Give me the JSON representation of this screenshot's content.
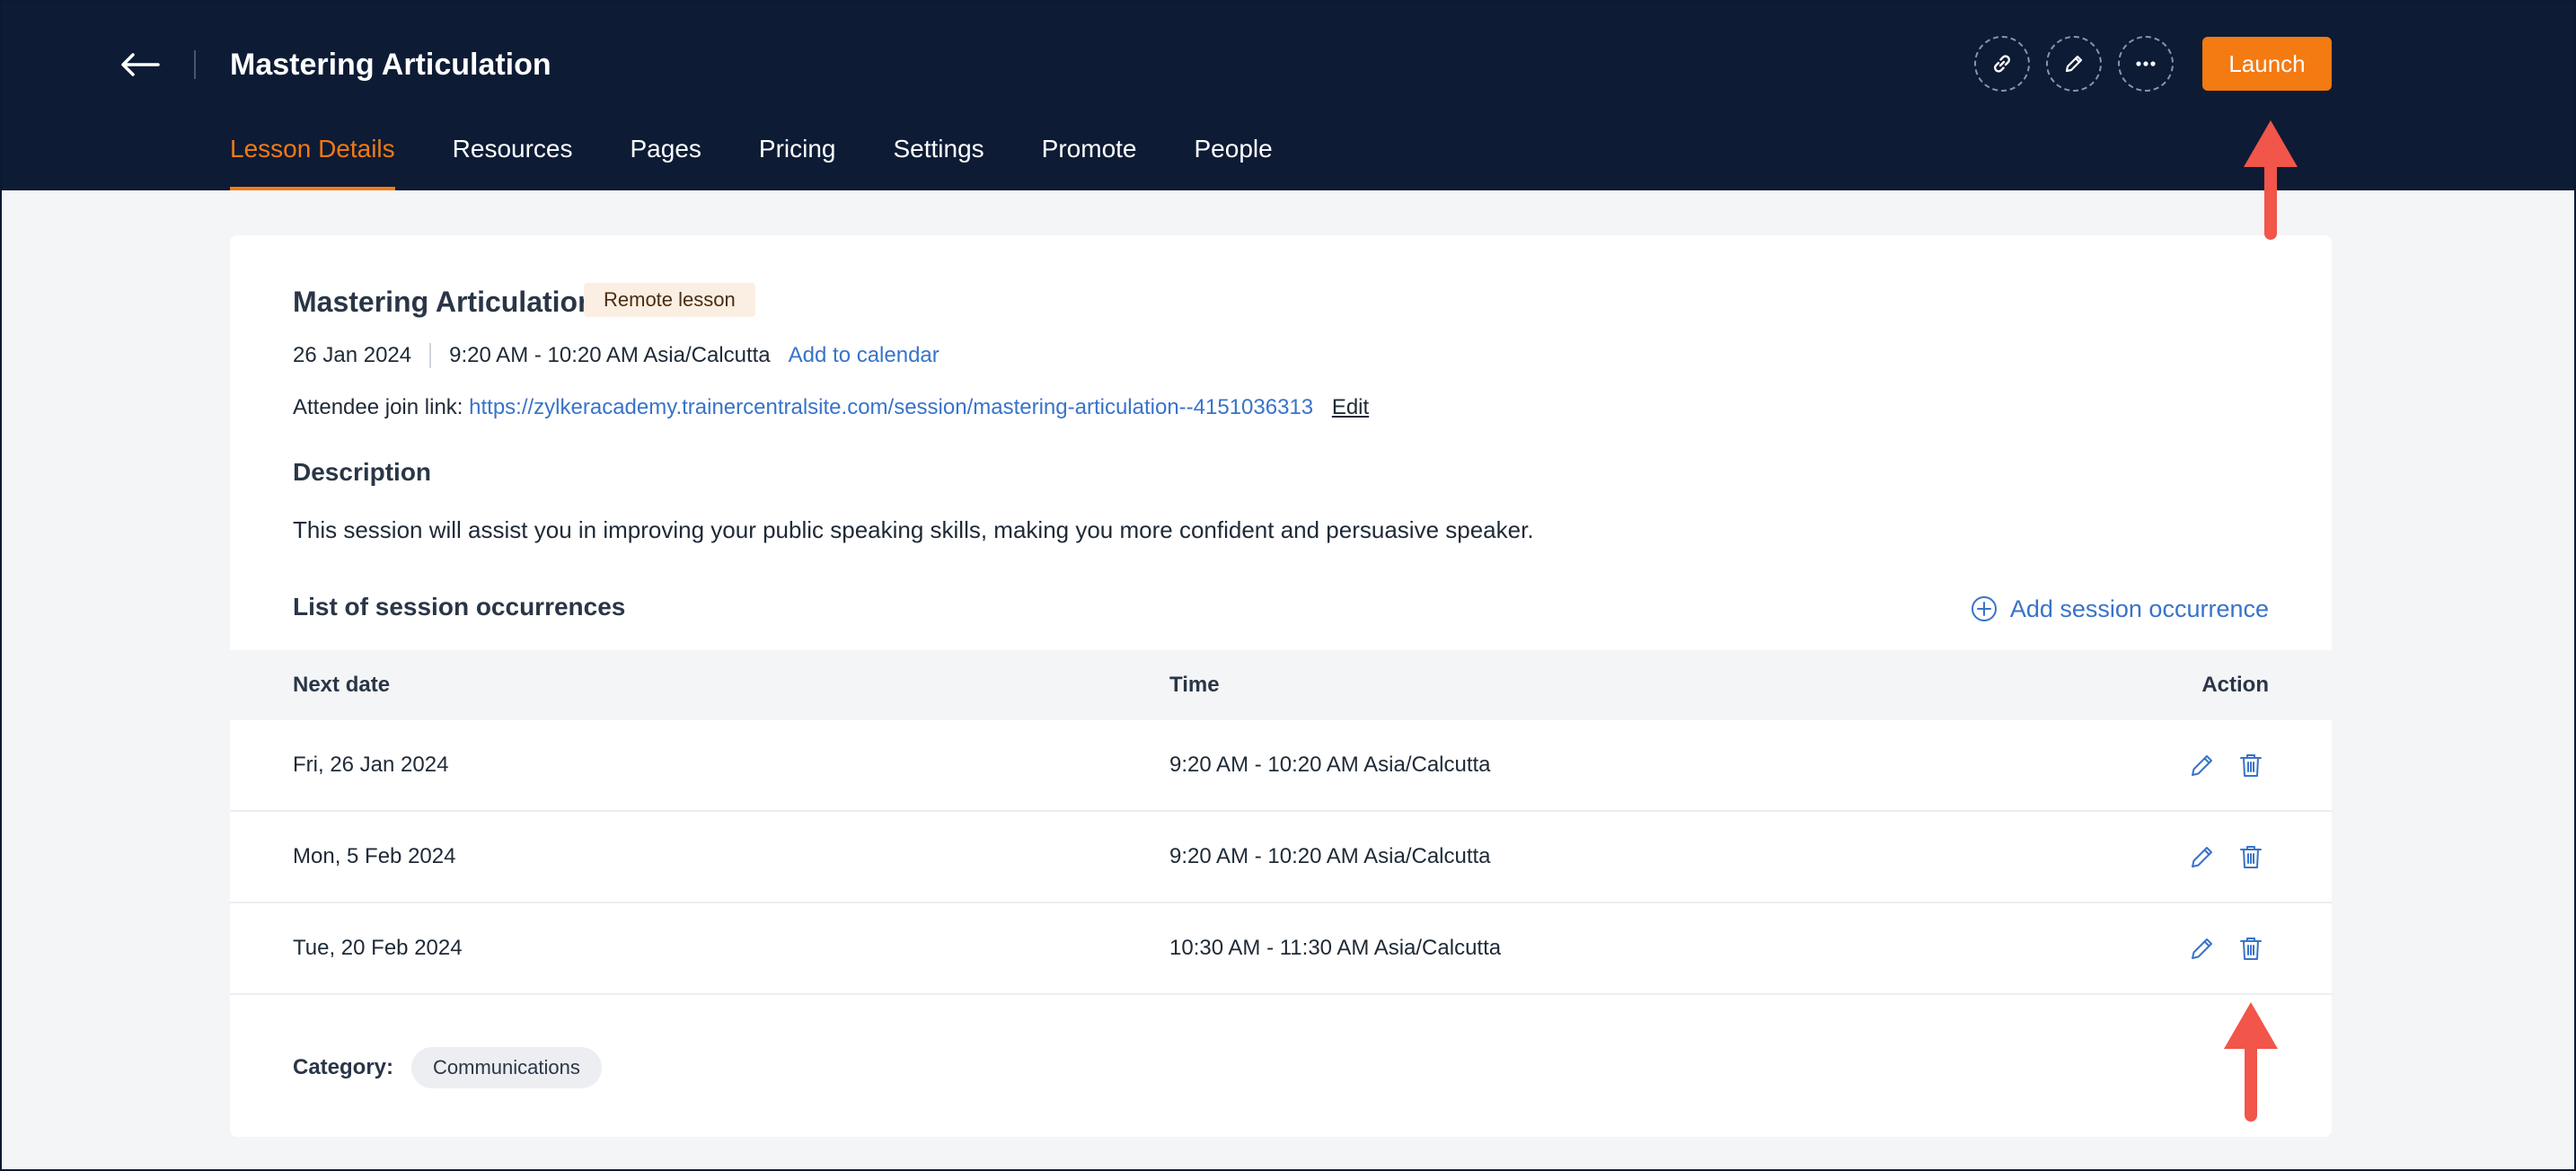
{
  "header": {
    "title": "Mastering Articulation",
    "launch_label": "Launch",
    "tabs": [
      {
        "label": "Lesson Details",
        "active": true
      },
      {
        "label": "Resources",
        "active": false
      },
      {
        "label": "Pages",
        "active": false
      },
      {
        "label": "Pricing",
        "active": false
      },
      {
        "label": "Settings",
        "active": false
      },
      {
        "label": "Promote",
        "active": false
      },
      {
        "label": "People",
        "active": false
      }
    ],
    "icons": [
      "back-arrow-icon",
      "link-icon",
      "pencil-icon",
      "more-icon"
    ]
  },
  "lesson": {
    "title": "Mastering Articulation",
    "badge": "Remote lesson",
    "date": "26 Jan 2024",
    "time": "9:20 AM - 10:20 AM Asia/Calcutta",
    "add_to_calendar": "Add to calendar",
    "join_label": "Attendee join link:",
    "join_url": "https://zylkeracademy.trainercentralsite.com/session/mastering-articulation--4151036313",
    "edit_label": "Edit",
    "description_heading": "Description",
    "description": "This session will assist you in improving your public speaking skills, making you more confident and persuasive speaker."
  },
  "occurrences": {
    "heading": "List of session occurrences",
    "add_label": "Add session occurrence",
    "columns": [
      "Next date",
      "Time",
      "Action"
    ],
    "rows": [
      {
        "date": "Fri, 26 Jan 2024",
        "time": "9:20 AM - 10:20 AM Asia/Calcutta"
      },
      {
        "date": "Mon, 5 Feb 2024",
        "time": "9:20 AM - 10:20 AM Asia/Calcutta"
      },
      {
        "date": "Tue, 20 Feb 2024",
        "time": "10:30 AM - 11:30 AM Asia/Calcutta"
      }
    ]
  },
  "category": {
    "label": "Category:",
    "value": "Communications"
  },
  "colors": {
    "header_bg": "#0d1b35",
    "accent": "#f47a12",
    "link": "#3873c9",
    "annotation": "#f2554a"
  }
}
